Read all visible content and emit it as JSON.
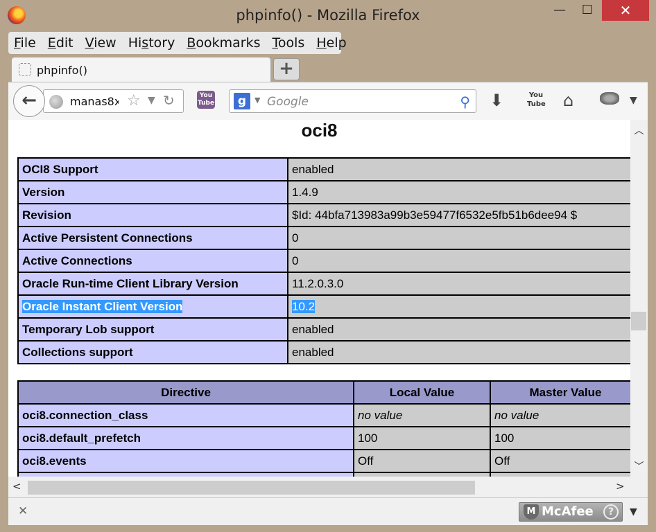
{
  "window": {
    "title": "phpinfo() - Mozilla Firefox",
    "minimize": "—",
    "maximize": "☐",
    "close": "✕"
  },
  "menu": [
    "File",
    "Edit",
    "View",
    "History",
    "Bookmarks",
    "Tools",
    "Help"
  ],
  "menu_access_keys": [
    "F",
    "E",
    "V",
    "s",
    "B",
    "T",
    "H"
  ],
  "tab": {
    "label": "phpinfo()"
  },
  "newtab_label": "+",
  "nav": {
    "back_glyph": "←",
    "url": "manas8x",
    "search_placeholder": "Google",
    "search_engine_letter": "g",
    "yt_ext_label": "You Tube",
    "yt_label": "You Tube"
  },
  "section": {
    "title": "oci8",
    "rows": [
      {
        "name": "OCI8 Support",
        "value": "enabled"
      },
      {
        "name": "Version",
        "value": "1.4.9"
      },
      {
        "name": "Revision",
        "value": "$Id: 44bfa713983a99b3e59477f6532e5fb51b6dee94 $"
      },
      {
        "name": "Active Persistent Connections",
        "value": "0"
      },
      {
        "name": "Active Connections",
        "value": "0"
      },
      {
        "name": "Oracle Run-time Client Library Version",
        "value": "11.2.0.3.0"
      },
      {
        "name": "Oracle Instant Client Version",
        "value": "10.2"
      },
      {
        "name": "Temporary Lob support",
        "value": "enabled"
      },
      {
        "name": "Collections support",
        "value": "enabled"
      }
    ]
  },
  "directives": {
    "headers": [
      "Directive",
      "Local Value",
      "Master Value"
    ],
    "rows": [
      {
        "name": "oci8.connection_class",
        "local": "no value",
        "master": "no value"
      },
      {
        "name": "oci8.default_prefetch",
        "local": "100",
        "master": "100"
      },
      {
        "name": "oci8.events",
        "local": "Off",
        "master": "Off"
      }
    ]
  },
  "statusbar": {
    "mcafee_label": "McAfee",
    "help_glyph": "?"
  },
  "colors": {
    "title_bar": "#b7a48c",
    "close_button": "#c7383c",
    "php_key_bg": "#ccccff",
    "php_value_bg": "#cccccc",
    "php_header_bg": "#9999cc",
    "selection": "#3399ff"
  }
}
